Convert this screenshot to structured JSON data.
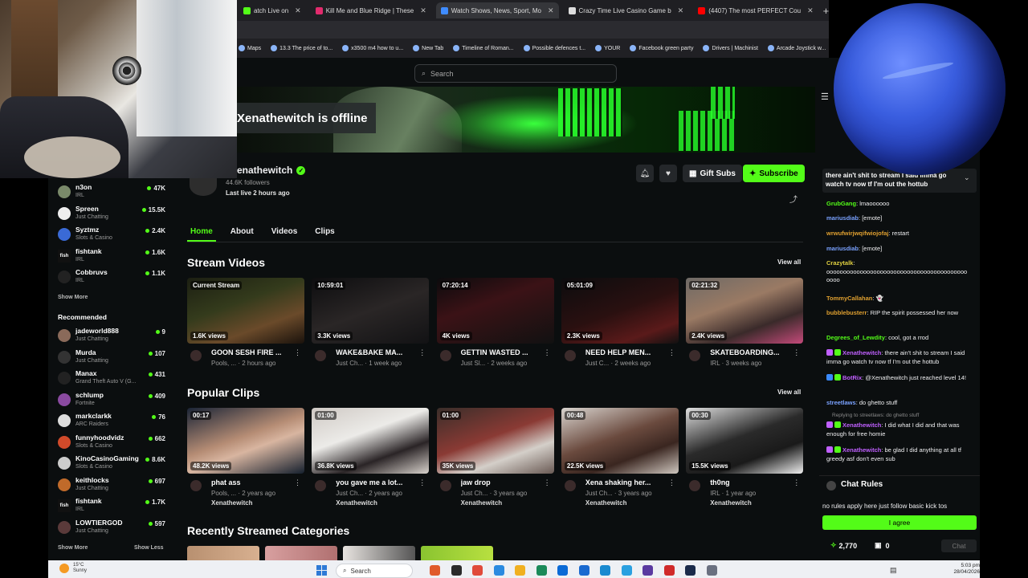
{
  "browser": {
    "tabs": [
      {
        "label": "atch Live on",
        "color": "#53fc18",
        "active": false
      },
      {
        "label": "Kill Me and Blue Ridge | These",
        "color": "#e22b6d",
        "active": false
      },
      {
        "label": "Watch Shows, News, Sport, Mo",
        "color": "#3f8cff",
        "active": true
      },
      {
        "label": "Crazy Time Live Casino Game b",
        "color": "#dddddd",
        "active": false
      },
      {
        "label": "(4407) The most PERFECT Cou",
        "color": "#ff0000",
        "active": false
      }
    ],
    "bookmarks": [
      "Maps",
      "13.3 The price of to...",
      "x3500 m4 how to u...",
      "New Tab",
      "Timeline of Roman...",
      "Possible defences t...",
      "YOUR",
      "Facebook green party",
      "Drivers | Machinist",
      "Arcade Joystick w..."
    ]
  },
  "kick": {
    "search_placeholder": "Search",
    "offline_text": "Xenathewitch is offline",
    "channel_name": "enathewitch",
    "followers": "44.6K followers",
    "last_live": "Last live 2 hours ago",
    "gift_subs": "Gift Subs",
    "subscribe": "Subscribe",
    "tabs": [
      "Home",
      "About",
      "Videos",
      "Clips"
    ],
    "stream_videos_title": "Stream Videos",
    "popular_clips_title": "Popular Clips",
    "recent_categories_title": "Recently Streamed Categories",
    "view_all": "View all",
    "stream_videos": [
      {
        "badge": "Current Stream",
        "views": "1.6K views",
        "title": "GOON SESH FIRE ...",
        "meta": "Pools, ... · 2 hours ago",
        "bg": "linear-gradient(160deg,#1c1f12,#343b1c 40%,#6a4a2a 70%,#1a120c)"
      },
      {
        "badge": "10:59:01",
        "views": "3.3K views",
        "title": "WAKE&BAKE MA...",
        "meta": "Just Ch... · 1 week ago",
        "bg": "linear-gradient(160deg,#0d0d0f,#2a2626 50%,#121214)"
      },
      {
        "badge": "07:20:14",
        "views": "4K views",
        "title": "GETTIN WASTED ...",
        "meta": "Just Sl... · 2 weeks ago",
        "bg": "linear-gradient(160deg,#0b0b0d,#3b1216 40%,#111)"
      },
      {
        "badge": "05:01:09",
        "views": "2.3K views",
        "title": "NEED HELP MEN...",
        "meta": "Just C... · 2 weeks ago",
        "bg": "linear-gradient(160deg,#0c0c0e,#2a1010 50%,#5a1a1a 80%,#111)"
      },
      {
        "badge": "02:21:32",
        "views": "2.4K views",
        "title": "SKATEBOARDING...",
        "meta": "IRL · 3 weeks ago",
        "bg": "linear-gradient(160deg,#6e6a66,#9a7a64 40%,#3a2a2a 70%,#c44a7a)"
      }
    ],
    "popular_clips": [
      {
        "badge": "00:17",
        "views": "48.2K views",
        "title": "phat ass",
        "meta": "Pools, ... · 2 years ago",
        "user": "Xenathewitch",
        "bg": "linear-gradient(160deg,#1a2436,#b58c74 45%,#d8b5a0 60%,#15202e)"
      },
      {
        "badge": "01:00",
        "views": "36.8K views",
        "title": "you gave me a lot...",
        "meta": "Just Ch... · 2 years ago",
        "user": "Xenathewitch",
        "bg": "linear-gradient(160deg,#cfc9c4,#ecebe8 40%,#2a2426 70%,#d8d2cc)"
      },
      {
        "badge": "01:00",
        "views": "35K views",
        "title": "jaw drop",
        "meta": "Just Ch... · 3 years ago",
        "user": "Xenathewitch",
        "bg": "linear-gradient(160deg,#3a2e2a,#8a3a34 45%,#d4cfc9 70%,#6a5a54)"
      },
      {
        "badge": "00:48",
        "views": "22.5K views",
        "title": "Xena shaking her...",
        "meta": "Just Ch... · 3 years ago",
        "user": "Xenathewitch",
        "bg": "linear-gradient(160deg,#dad5d0,#6a4a3e 45%,#3a2620 70%,#cfc7bf)"
      },
      {
        "badge": "00:30",
        "views": "15.5K views",
        "title": "th0ng",
        "meta": "IRL · 1 year ago",
        "user": "Xenathewitch",
        "bg": "linear-gradient(160deg,#e0e0e0,#2a2a2a 45%,#1a1a1a 70%,#efefef)"
      }
    ],
    "categories": [
      {
        "bg": "linear-gradient(90deg,#b89070,#d8b090)"
      },
      {
        "bg": "linear-gradient(90deg,#d8a0a0,#b07070)"
      },
      {
        "bg": "linear-gradient(90deg,#e8e4e0,#555)"
      },
      {
        "bg": "linear-gradient(90deg,#8ac430,#b8e040)"
      }
    ]
  },
  "sidebar": {
    "following": [
      {
        "name": "n3on",
        "category": "IRL",
        "viewers": "47K",
        "color": "#7a8a6a"
      },
      {
        "name": "Spreen",
        "category": "Just Chatting",
        "viewers": "15.5K",
        "color": "#eeeeee"
      },
      {
        "name": "Syztmz",
        "category": "Slots & Casino",
        "viewers": "2.4K",
        "color": "#3a6ad6"
      },
      {
        "name": "fishtank",
        "category": "IRL",
        "viewers": "1.6K",
        "color": "#111111",
        "logo": "fish"
      },
      {
        "name": "Cobbruvs",
        "category": "IRL",
        "viewers": "1.1K",
        "color": "#222222"
      }
    ],
    "show_more": "Show More",
    "recommended_label": "Recommended",
    "recommended": [
      {
        "name": "jadeworld888",
        "category": "Just Chatting",
        "viewers": "9",
        "color": "#8a6a5a"
      },
      {
        "name": "Murda",
        "category": "Just Chatting",
        "viewers": "107",
        "color": "#333333"
      },
      {
        "name": "Manax",
        "category": "Grand Theft Auto V (G...",
        "viewers": "431",
        "color": "#222222"
      },
      {
        "name": "schlump",
        "category": "Fortnite",
        "viewers": "409",
        "color": "#8a4aa0"
      },
      {
        "name": "markclarkk",
        "category": "ARC Raiders",
        "viewers": "76",
        "color": "#dddddd"
      },
      {
        "name": "funnyhoodvidz",
        "category": "Slots & Casino",
        "viewers": "662",
        "color": "#d04a2a"
      },
      {
        "name": "KinoCasinoGaming",
        "category": "Slots & Casino",
        "viewers": "8.6K",
        "color": "#cccccc"
      },
      {
        "name": "keithlocks",
        "category": "Just Chatting",
        "viewers": "697",
        "color": "#c06a2a"
      },
      {
        "name": "fishtank",
        "category": "IRL",
        "viewers": "1.7K",
        "color": "#111111",
        "logo": "fish"
      },
      {
        "name": "LOWTIERGOD",
        "category": "Just Chatting",
        "viewers": "597",
        "color": "#5a3a3a"
      }
    ],
    "show_less": "Show Less"
  },
  "chat": {
    "pinned": "there ain't shit to stream I said imma go watch tv now tf I'm out the hottub",
    "messages": [
      {
        "user": "GrubGang",
        "color": "#53fc18",
        "text": "lmaoooooo"
      },
      {
        "user": "mariusdiab",
        "color": "#7aa2ff",
        "text": "[emote]"
      },
      {
        "user": "wrwufwirjwqifwiojofaj",
        "color": "#e0a030",
        "text": "restart"
      },
      {
        "user": "mariusdiab",
        "color": "#7aa2ff",
        "text": "[emote]"
      },
      {
        "user": "Crazytalk",
        "color": "#e0d040",
        "text": "oooooooooooooooooooooooooooooooooooooooooo oooo"
      },
      {
        "user": "TommyCallahan",
        "color": "#e0a030",
        "text": "👻"
      },
      {
        "user": "bubblebusterr",
        "color": "#e0a030",
        "text": "RIP the spirit possessed her now"
      },
      {
        "user": "Degrees_of_Lewdity",
        "color": "#53fc18",
        "text": "cool, got a rrod"
      },
      {
        "user": "Xenathewitch",
        "color": "#c060ff",
        "text": "there ain't shit to stream I said imma go watch tv now tf I'm out the hottub",
        "badges": [
          "#c060ff",
          "#53fc18"
        ]
      },
      {
        "user": "BotRix",
        "color": "#c060ff",
        "text": "@Xenathewitch just reached level 14!",
        "badges": [
          "#3a8aff",
          "#53fc18"
        ]
      },
      {
        "user": "streetlaws",
        "color": "#7aa2ff",
        "text": "do ghetto stuff"
      },
      {
        "user": "Xenathewitch",
        "color": "#c060ff",
        "text": "I did what I did and that was enough for free homie",
        "badges": [
          "#c060ff",
          "#53fc18"
        ],
        "reply": "Replying to streetlaws: do ghetto stuff"
      },
      {
        "user": "Xenathewitch",
        "color": "#c060ff",
        "text": "be glad I did anything at all tf greedy asf don't even sub",
        "badges": [
          "#c060ff",
          "#53fc18"
        ]
      }
    ],
    "rules_title": "Chat Rules",
    "rules_text": "no rules apply here just follow basic kick tos",
    "agree": "I agree",
    "points": "2,770",
    "gifts": "0",
    "chat_button": "Chat"
  },
  "taskbar": {
    "temp": "15°C",
    "weather": "Sunny",
    "search": "Search",
    "time": "5:03 pm",
    "date": "28/04/2026",
    "icons": [
      "#e05a2a",
      "#2a2a2a",
      "#e04a3a",
      "#2a8ae0",
      "#f0b020",
      "#1a8a5a",
      "#0a6ad6",
      "#1a6ad0",
      "#1a8ad0",
      "#2aa0e0",
      "#5a3aa0",
      "#d02a2a",
      "#1a2a4a",
      "#6a7080"
    ]
  }
}
